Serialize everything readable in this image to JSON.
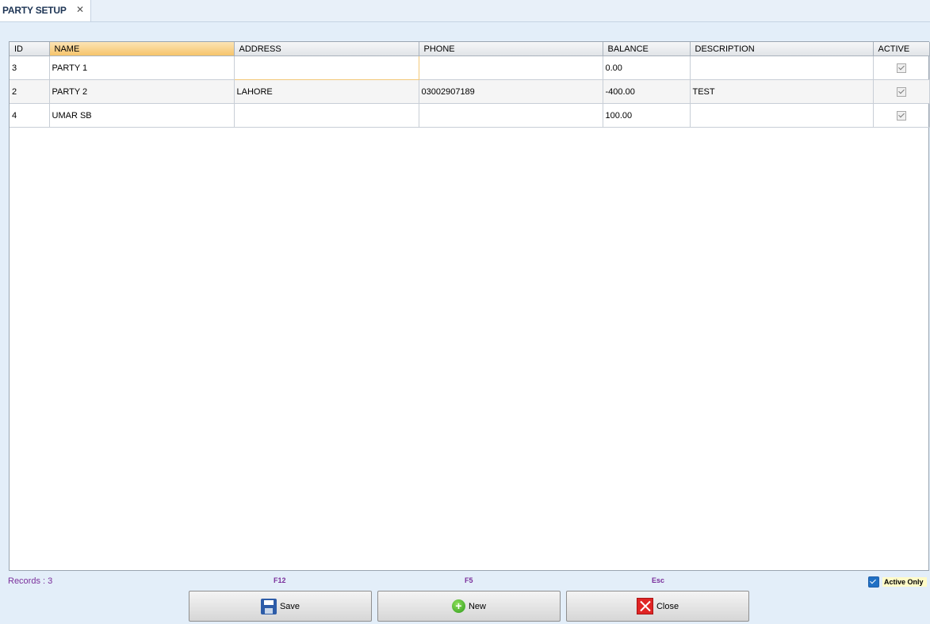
{
  "tab": {
    "title": "PARTY SETUP",
    "close": "✕"
  },
  "grid": {
    "columns": [
      "ID",
      "NAME",
      "ADDRESS",
      "PHONE",
      "BALANCE",
      "DESCRIPTION",
      "ACTIVE"
    ],
    "sorted_column": "NAME",
    "rows": [
      {
        "id": "3",
        "name": "PARTY 1",
        "address": "",
        "phone": "",
        "balance": "0.00",
        "description": "",
        "active": true
      },
      {
        "id": "2",
        "name": "PARTY 2",
        "address": "LAHORE",
        "phone": "03002907189",
        "balance": "-400.00",
        "description": "TEST",
        "active": true
      },
      {
        "id": "4",
        "name": "UMAR SB",
        "address": "",
        "phone": "",
        "balance": "100.00",
        "description": "",
        "active": true
      }
    ]
  },
  "footer": {
    "records": "Records : 3",
    "shortcuts": {
      "save": "F12",
      "new": "F5",
      "close": "Esc"
    },
    "buttons": {
      "save": "Save",
      "new": "New",
      "close": "Close"
    },
    "active_only": {
      "label": "Active Only",
      "checked": true
    }
  },
  "icons": {
    "save": "floppy-disk-icon",
    "new": "plus-circle-icon",
    "close": "red-x-icon"
  },
  "colors": {
    "sorted_header": "#f6c46b",
    "shortcut_text": "#7a2f9b",
    "active_only_bg": "#fffbc8"
  }
}
